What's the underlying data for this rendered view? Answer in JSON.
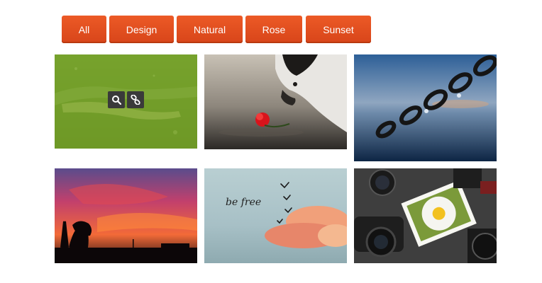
{
  "filters": {
    "all": "All",
    "design": "Design",
    "natural": "Natural",
    "rose": "Rose",
    "sunset": "Sunset"
  },
  "gallery": {
    "items": [
      {
        "subject": "hand under water",
        "overlay_color": "#7aaa1e",
        "hover_icons": [
          "search-icon",
          "link-icon"
        ]
      },
      {
        "subject": "husky with red rose"
      },
      {
        "subject": "chain with water drops"
      },
      {
        "subject": "red sunset sky with trees"
      },
      {
        "subject": "birds over clouds with handwritten text"
      },
      {
        "subject": "cameras and daisy photo"
      }
    ],
    "handwriting": "be free"
  },
  "colors": {
    "accent": "#e24e1c",
    "hover_overlay": "#7aaa1e",
    "icon_button": "#3a3a3a"
  }
}
